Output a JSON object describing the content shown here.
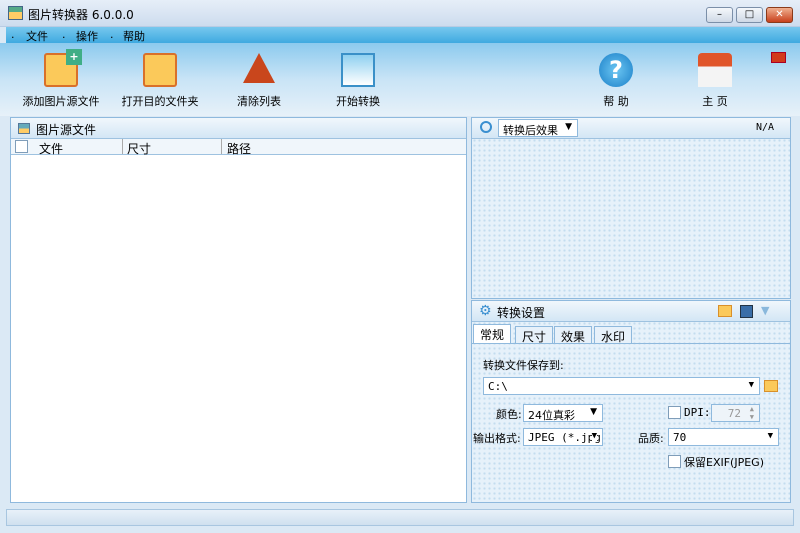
{
  "window": {
    "title": "图片转换器 6.0.0.0",
    "minimize": "–",
    "maximize": "□",
    "close": "✕"
  },
  "menu": [
    "文件",
    "操作",
    "帮助"
  ],
  "toolbar": {
    "add": "添加图片源文件",
    "open": "打开目的文件夹",
    "clear": "清除列表",
    "start": "开始转换",
    "help": "帮 助",
    "home": "主 页"
  },
  "source_panel": {
    "title": "图片源文件",
    "columns": [
      "文件",
      "尺寸",
      "路径"
    ]
  },
  "preview_panel": {
    "mode": "转换后效果",
    "info": "N/A"
  },
  "settings": {
    "title": "转换设置",
    "tabs": [
      "常规",
      "尺寸",
      "效果",
      "水印"
    ],
    "save_to_label": "转换文件保存到:",
    "save_to": "C:\\",
    "color_label": "颜色:",
    "color": "24位真彩",
    "format_label": "输出格式:",
    "format": "JPEG (*.jpg",
    "dpi_label": "DPI:",
    "dpi": "72",
    "quality_label": "品质:",
    "quality": "70",
    "exif_label": "保留EXIF(JPEG)"
  }
}
